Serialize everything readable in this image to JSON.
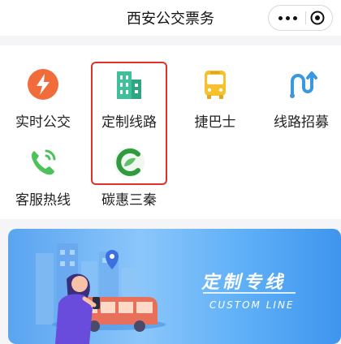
{
  "header": {
    "title": "西安公交票务"
  },
  "grid": {
    "items": [
      {
        "label": "实时公交",
        "icon": "lightning-icon"
      },
      {
        "label": "定制线路",
        "icon": "building-icon"
      },
      {
        "label": "捷巴士",
        "icon": "bus-icon"
      },
      {
        "label": "线路招募",
        "icon": "recruit-route-icon"
      },
      {
        "label": "客服热线",
        "icon": "phone-icon"
      },
      {
        "label": "碳惠三秦",
        "icon": "leaf-c-icon"
      }
    ],
    "highlighted_item": "定制线路"
  },
  "banner": {
    "title": "定制专线",
    "subtitle": "CUSTOM LINE"
  },
  "colors": {
    "realtime_icon": "#f26b3a",
    "custom_icon": "#3fbf9a",
    "jiebus_icon": "#f6c12c",
    "recruit_icon": "#3a98e0",
    "hotline_icon": "#4cc25a",
    "carbon_icon": "#2f9a3e",
    "highlight": "#e0302a",
    "banner": "#5fb0f7"
  }
}
